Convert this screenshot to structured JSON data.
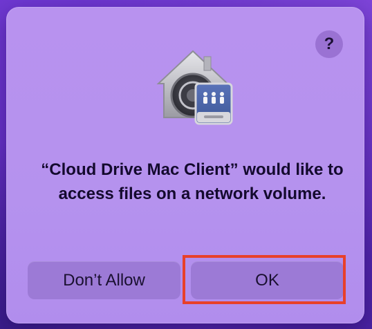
{
  "dialog": {
    "message": "“Cloud Drive Mac Client” would like to access files on a network volume.",
    "help_label": "?",
    "icon": "network-volume-security-icon",
    "buttons": {
      "dont_allow_label": "Don’t Allow",
      "ok_label": "OK"
    }
  },
  "colors": {
    "dialog_background": "#b892ef",
    "button_background": "#9c7ad6",
    "highlight_border": "#e8402a",
    "text": "#140a2e"
  }
}
